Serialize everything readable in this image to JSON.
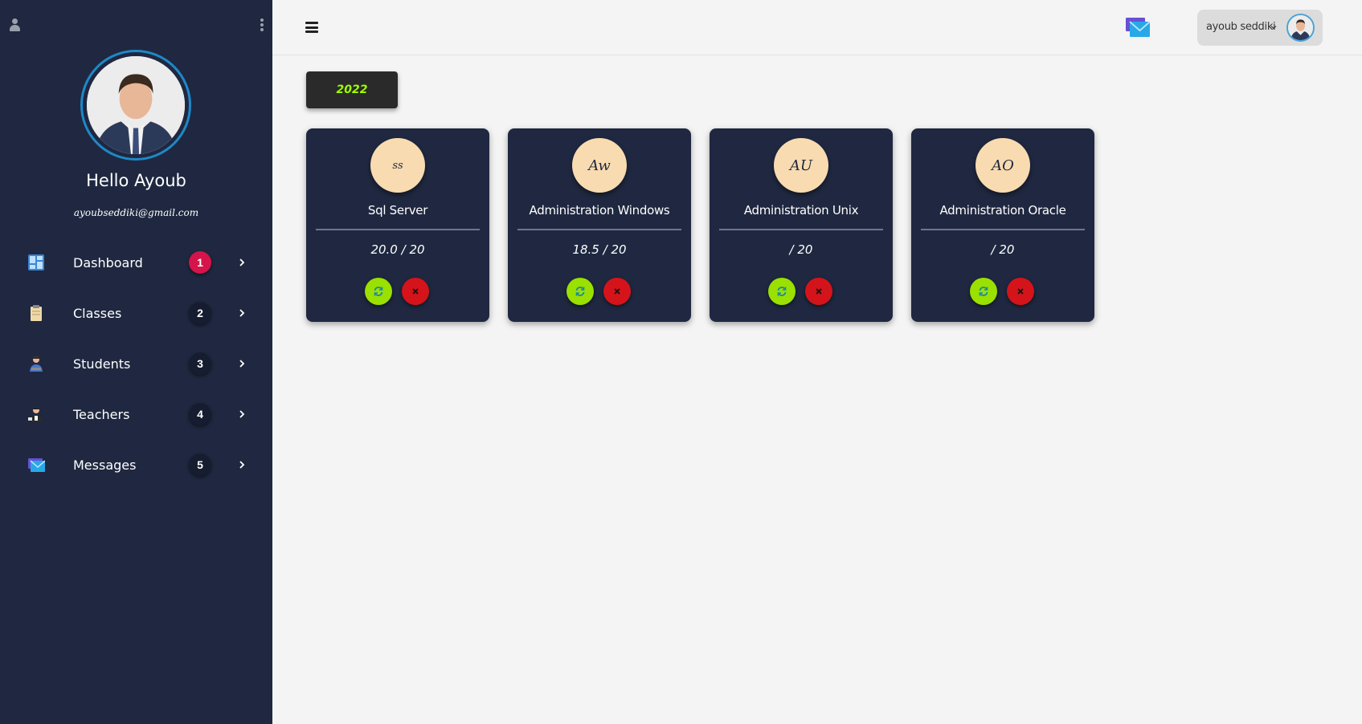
{
  "sidebar": {
    "greeting": "Hello Ayoub",
    "email": "ayoubseddiki@gmail.com",
    "nav": [
      {
        "label": "Dashboard",
        "badge": "1",
        "icon": "dashboard-icon"
      },
      {
        "label": "Classes",
        "badge": "2",
        "icon": "clipboard-icon"
      },
      {
        "label": "Students",
        "badge": "3",
        "icon": "student-icon"
      },
      {
        "label": "Teachers",
        "badge": "4",
        "icon": "teacher-icon"
      },
      {
        "label": "Messages",
        "badge": "5",
        "icon": "mail-icon"
      }
    ]
  },
  "topbar": {
    "username": "ayoub seddiki"
  },
  "year_button": "2022",
  "courses": [
    {
      "initials": "ss",
      "title": "Sql Server",
      "score": "20.0 / 20"
    },
    {
      "initials": "Aw",
      "title": "Administration Windows",
      "score": "18.5 / 20"
    },
    {
      "initials": "AU",
      "title": "Administration Unix",
      "score": "/ 20"
    },
    {
      "initials": "AO",
      "title": "Administration Oracle",
      "score": "/ 20"
    }
  ],
  "colors": {
    "sidebar_bg": "#1f2840",
    "page_bg": "#f4f4f4",
    "accent_green": "#9ae000",
    "accent_red": "#d4141a",
    "badge_red": "#d4144a",
    "avatar_bg": "#f8dbb0",
    "year_text": "#9dff00"
  }
}
